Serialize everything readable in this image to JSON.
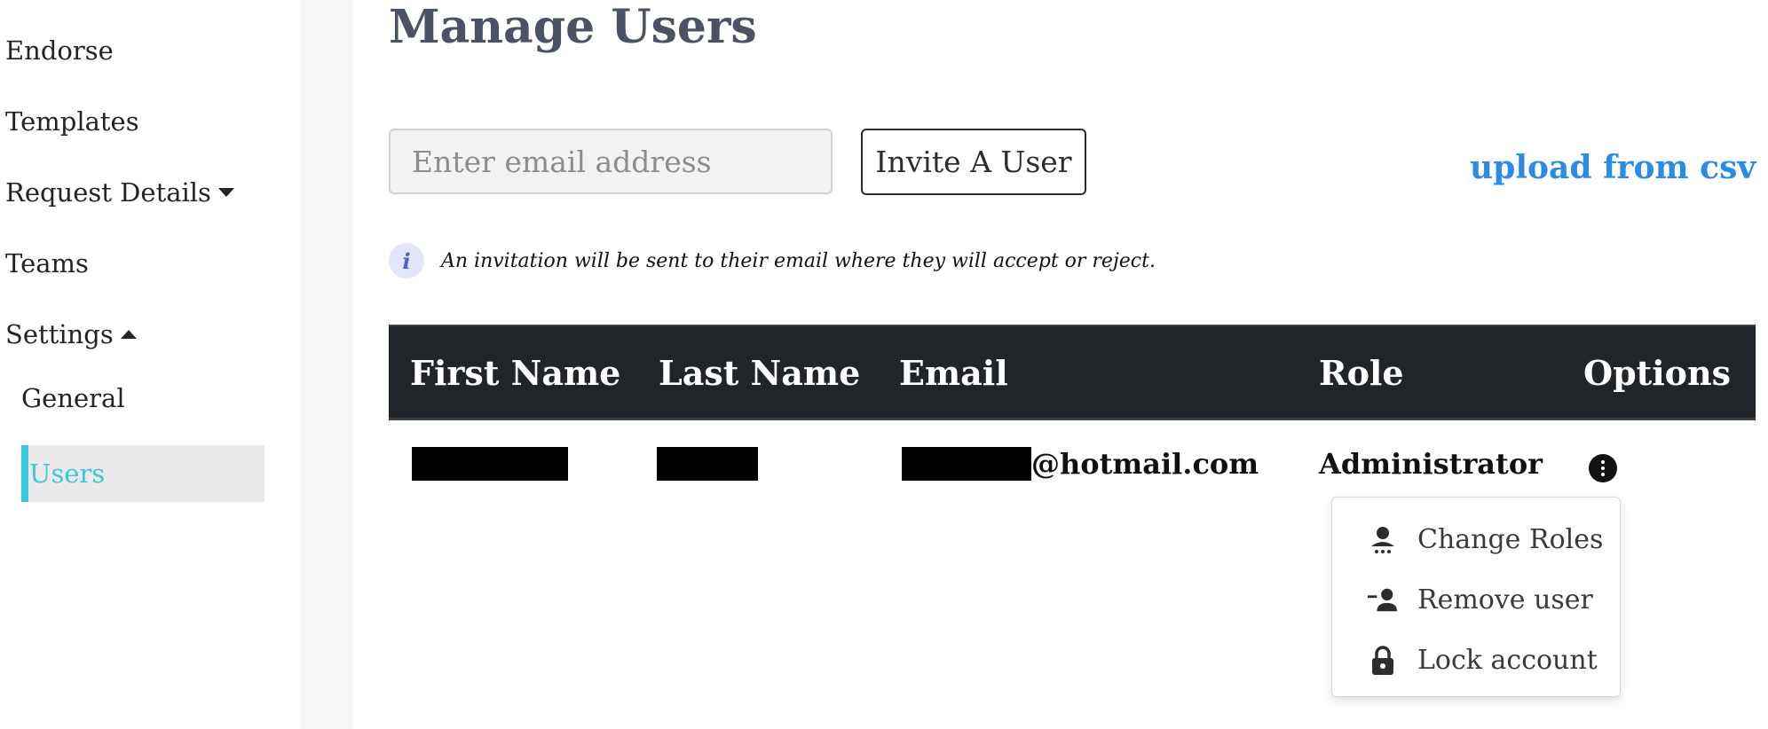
{
  "sidebar": {
    "items": [
      {
        "label": "Endorse"
      },
      {
        "label": "Templates"
      },
      {
        "label": "Request Details"
      },
      {
        "label": "Teams"
      },
      {
        "label": "Settings"
      }
    ],
    "settings_subitems": [
      {
        "label": "General"
      },
      {
        "label": "Users",
        "active": true
      }
    ]
  },
  "page": {
    "title": "Manage Users"
  },
  "invite": {
    "email_placeholder": "Enter email address",
    "email_value": "",
    "button_label": "Invite A User",
    "csv_link": "upload from csv",
    "info_icon_glyph": "i",
    "info_text": "An invitation will be sent to their email where they will accept or reject."
  },
  "table": {
    "headers": [
      "First Name",
      "Last Name",
      "Email",
      "Role",
      "Options"
    ],
    "rows": [
      {
        "first_name": "[redacted]",
        "last_name": "[redacted]",
        "email_suffix": "@hotmail.com",
        "role": "Administrator"
      }
    ]
  },
  "options_menu": {
    "items": [
      {
        "label": "Change Roles",
        "icon": "change-roles-icon"
      },
      {
        "label": "Remove user",
        "icon": "remove-user-icon"
      },
      {
        "label": "Lock account",
        "icon": "lock-icon"
      }
    ]
  },
  "colors": {
    "accent": "#3cc7dc",
    "link": "#2b8be6",
    "table_header_bg": "#212529",
    "title": "#4a5263"
  }
}
